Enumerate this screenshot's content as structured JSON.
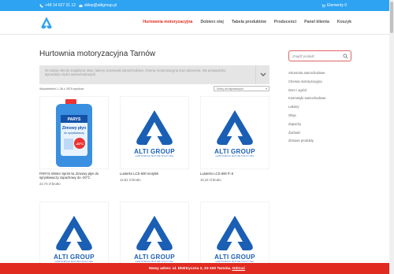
{
  "topbar": {
    "phone": "+48 14 627 31 12",
    "email": "sklep@altigroup.pl",
    "cart": "Elementy 0"
  },
  "nav": {
    "items": [
      {
        "label": "Hurtownia motoryzacyjna",
        "active": true
      },
      {
        "label": "Dobierz olej",
        "active": false
      },
      {
        "label": "Tabela produktów",
        "active": false
      },
      {
        "label": "Producenci",
        "active": false
      },
      {
        "label": "Panel klienta",
        "active": false
      },
      {
        "label": "Koszyk",
        "active": false
      }
    ]
  },
  "page": {
    "title": "Hurtownia motoryzacyjna Tarnów",
    "info": "W naszej ofercie znajdziesz oleje, lakiery, kosmetyki samochodowe, chemię motoryzacyjną oraz akcesoria. Nie prowadzimy sprzedaży części samochodowych.",
    "results": "Wyświetlanie 1–36 z 3579 wyników",
    "sort": "Sortuj od najnowszych"
  },
  "products": [
    {
      "name": "PARYS Winter Sprint 5L Zimowy płyn do spryskiwaczy zapachowy do -20°C",
      "price": "22,73 zł brutto",
      "image": "washer-fluid"
    },
    {
      "name": "Lusterko LCD 600 motylek",
      "price": "14,81 zł brutto",
      "image": "alti-logo"
    },
    {
      "name": "Lusterko LCD 600 Fi 8",
      "price": "15,23 zł brutto",
      "image": "alti-logo"
    },
    {
      "name": "",
      "price": "",
      "image": "alti-logo"
    },
    {
      "name": "",
      "price": "",
      "image": "alti-logo"
    },
    {
      "name": "",
      "price": "",
      "image": "alti-logo"
    }
  ],
  "logo": {
    "title": "ALTI GROUP",
    "subtitle": "HURTOWNIA MOTORYZACYJNA"
  },
  "washer_label": {
    "brand": "PARYS",
    "line1": "Zimowy płyn",
    "line2": "do spryskiwaczy",
    "temp": "-20°C"
  },
  "sidebar": {
    "search_placeholder": "Znajdź produkt",
    "categories": [
      "Akcesoria samochodowe",
      "Chemia motoryzacyjna",
      "Dom i ogród",
      "Kosmetyki samochodowe",
      "Lakiery",
      "Oleje",
      "Zapachy",
      "Żarówki",
      "Zimowe produkty"
    ]
  },
  "banner": {
    "text": "Nowy adres: ul. Elektryczna 2, 33-100 Tarnów,",
    "link": "Odrzuć"
  },
  "colors": {
    "accent": "#2ea3f2",
    "red": "#e02b20",
    "brand_blue": "#1a5fb4"
  }
}
